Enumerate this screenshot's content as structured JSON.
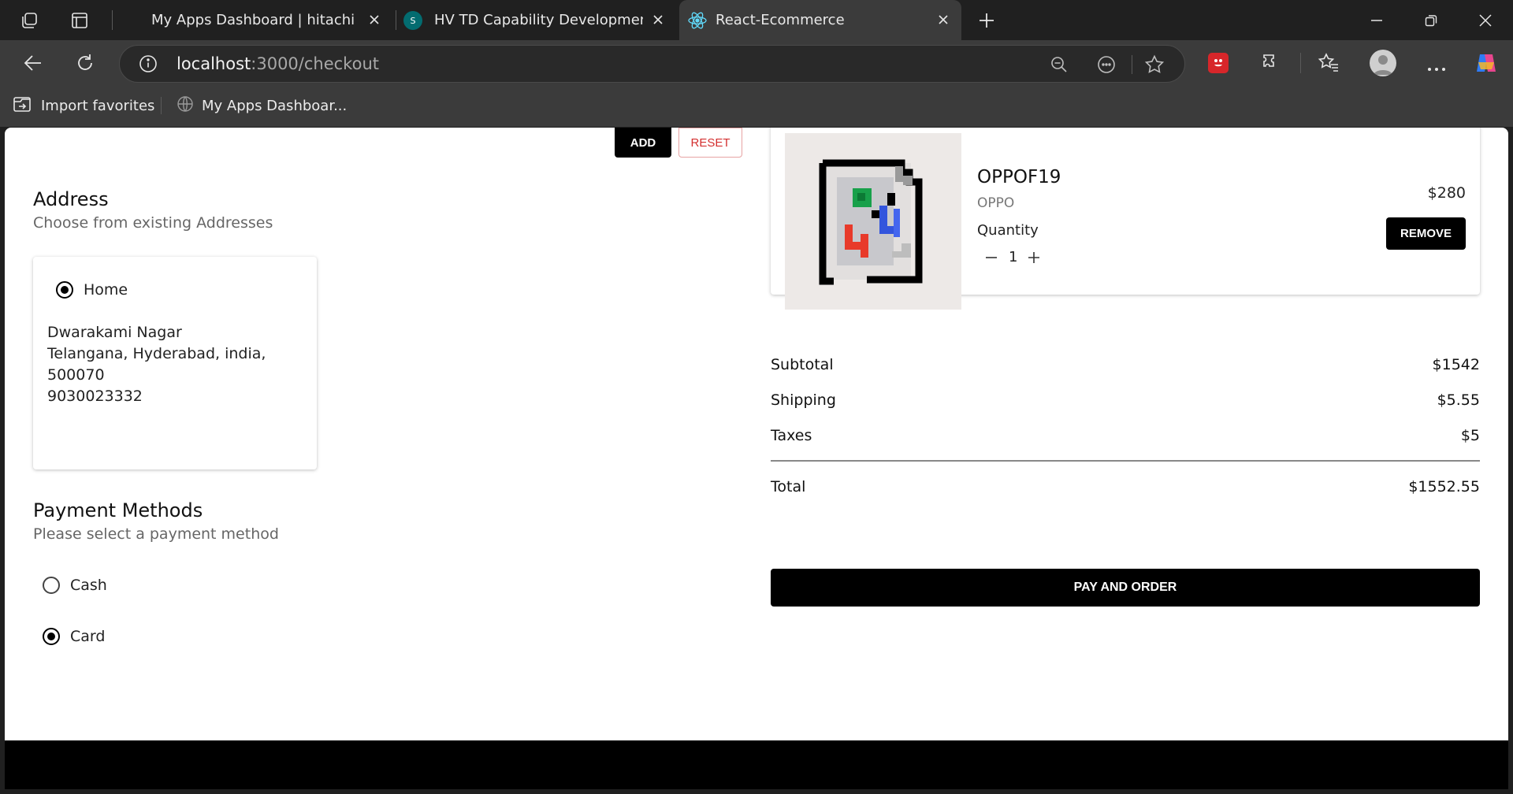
{
  "browser": {
    "tabs": [
      {
        "title": "My Apps Dashboard | hitachivantara",
        "active": false
      },
      {
        "title": "HV TD Capability Development (LMS)",
        "active": false
      },
      {
        "title": "React-Ecommerce",
        "active": true
      }
    ],
    "url_host": "localhost",
    "url_path": ":3000/checkout",
    "bookmarks": [
      {
        "label": "Import favorites",
        "icon": "import-icon"
      },
      {
        "label": "My Apps Dashboar...",
        "icon": "globe-icon"
      }
    ],
    "colors": {
      "tabbar": "#202020",
      "toolbar": "#3b3b3b",
      "urlbar": "#292929"
    }
  },
  "form_actions": {
    "add_label": "ADD",
    "reset_label": "RESET"
  },
  "address": {
    "title": "Address",
    "subtitle": "Choose from existing Addresses",
    "selected": {
      "label": "Home",
      "checked": true,
      "lines": [
        "Dwarakami Nagar",
        "Telangana, Hyderabad, india,",
        "500070",
        "9030023332"
      ]
    }
  },
  "payment": {
    "title": "Payment Methods",
    "subtitle": "Please select a payment method",
    "options": [
      {
        "label": "Cash",
        "checked": false
      },
      {
        "label": "Card",
        "checked": true
      }
    ]
  },
  "cart": {
    "item": {
      "name": "OPPOF19",
      "brand": "OPPO",
      "price": "$280",
      "quantity_label": "Quantity",
      "quantity": "1",
      "remove_label": "REMOVE",
      "image": "broken-image-icon"
    },
    "summary": [
      {
        "label": "Subtotal",
        "value": "$1542"
      },
      {
        "label": "Shipping",
        "value": "$5.55"
      },
      {
        "label": "Taxes",
        "value": "$5"
      }
    ],
    "total": {
      "label": "Total",
      "value": "$1552.55"
    },
    "pay_label": "PAY AND ORDER"
  },
  "colors": {
    "accent": "#000000",
    "reset": "#d32f2f",
    "thumb_bg": "#ede9e7"
  }
}
